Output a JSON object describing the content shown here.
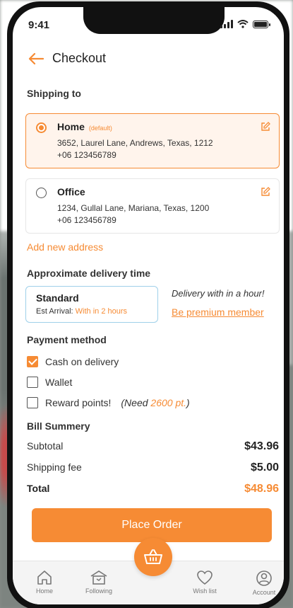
{
  "status": {
    "time": "9:41"
  },
  "header": {
    "title": "Checkout"
  },
  "shipping": {
    "label": "Shipping to",
    "addresses": [
      {
        "name": "Home",
        "tag": "(default)",
        "line": "3652,   Laurel Lane, Andrews, Texas, 1212",
        "phone": "+06 123456789",
        "selected": true
      },
      {
        "name": "Office",
        "tag": "",
        "line": "1234,   Gullal Lane, Mariana, Texas, 1200",
        "phone": "+06 123456789",
        "selected": false
      }
    ],
    "add_new": "Add new address"
  },
  "delivery": {
    "label": "Approximate delivery time",
    "option_title": "Standard",
    "est_prefix": "Est Arrival:",
    "est_value": "With in 2 hours",
    "promo_text": "Delivery with in a hour!",
    "promo_link": "Be premium member"
  },
  "payment": {
    "label": "Payment method",
    "options": [
      {
        "label": "Cash on delivery",
        "checked": true
      },
      {
        "label": "Wallet",
        "checked": false
      },
      {
        "label": "Reward points!",
        "checked": false
      }
    ],
    "reward_note_prefix": "(Need",
    "reward_note_value": "2600 pt.",
    "reward_note_suffix": ")"
  },
  "bill": {
    "label": "Bill Summery",
    "subtotal_label": "Subtotal",
    "subtotal_value": "$43.96",
    "shipping_label": "Shipping fee",
    "shipping_value": "$5.00",
    "total_label": "Total",
    "total_value": "$48.96"
  },
  "actions": {
    "place_order": "Place Order"
  },
  "nav": {
    "home": "Home",
    "following": "Following",
    "wishlist": "Wish list",
    "account": "Account"
  },
  "colors": {
    "accent": "#f68b34",
    "delivery_border": "#9fd0ea"
  }
}
